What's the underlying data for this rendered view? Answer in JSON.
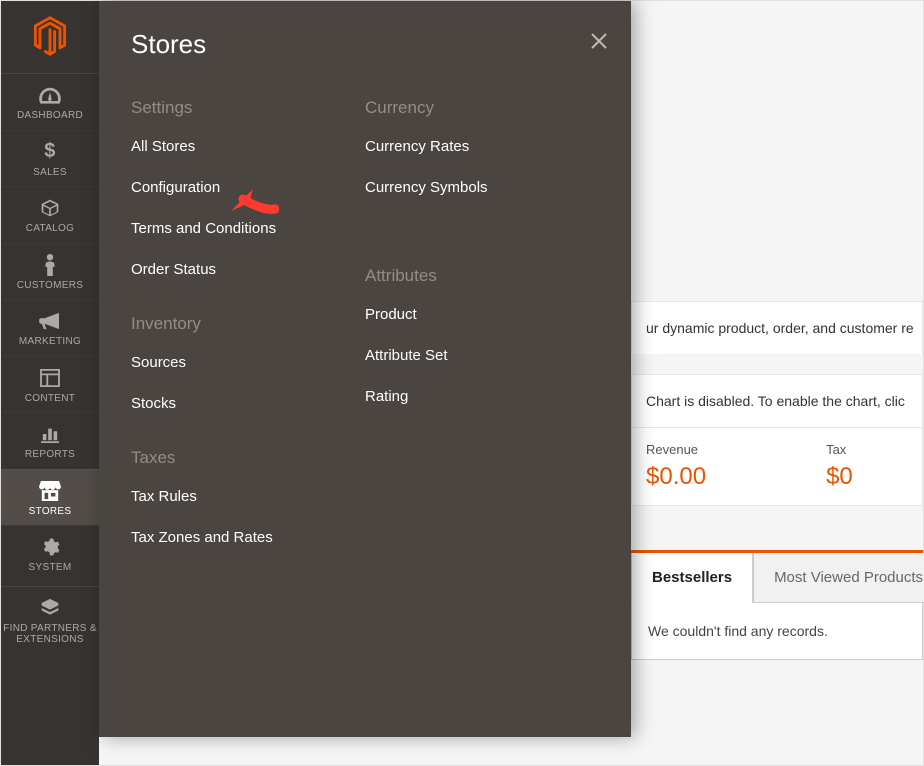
{
  "flyout": {
    "title": "Stores",
    "left": {
      "settings": {
        "heading": "Settings",
        "all_stores": "All Stores",
        "configuration": "Configuration",
        "terms": "Terms and Conditions",
        "order_status": "Order Status"
      },
      "inventory": {
        "heading": "Inventory",
        "sources": "Sources",
        "stocks": "Stocks"
      },
      "taxes": {
        "heading": "Taxes",
        "tax_rules": "Tax Rules",
        "tax_zones": "Tax Zones and Rates"
      }
    },
    "right": {
      "currency": {
        "heading": "Currency",
        "rates": "Currency Rates",
        "symbols": "Currency Symbols"
      },
      "attributes": {
        "heading": "Attributes",
        "product": "Product",
        "attribute_set": "Attribute Set",
        "rating": "Rating"
      }
    }
  },
  "rail": {
    "dashboard": "Dashboard",
    "sales": "Sales",
    "catalog": "Catalog",
    "customers": "Customers",
    "marketing": "Marketing",
    "content": "Content",
    "reports": "Reports",
    "stores": "Stores",
    "system": "System",
    "find_partners": "Find Partners & Extensions"
  },
  "content": {
    "dynamic_text": "ur dynamic product, order, and customer re",
    "chart_notice": "Chart is disabled. To enable the chart, clic",
    "stats": {
      "revenue_label": "Revenue",
      "revenue_value": "$0.00",
      "tax_label": "Tax",
      "tax_value": "$0"
    },
    "tabs": {
      "bestsellers": "Bestsellers",
      "most_viewed": "Most Viewed Products"
    },
    "empty": "We couldn't find any records."
  },
  "colors": {
    "accent": "#e85500",
    "rail_bg": "#373330",
    "flyout_bg": "#4a4540"
  }
}
